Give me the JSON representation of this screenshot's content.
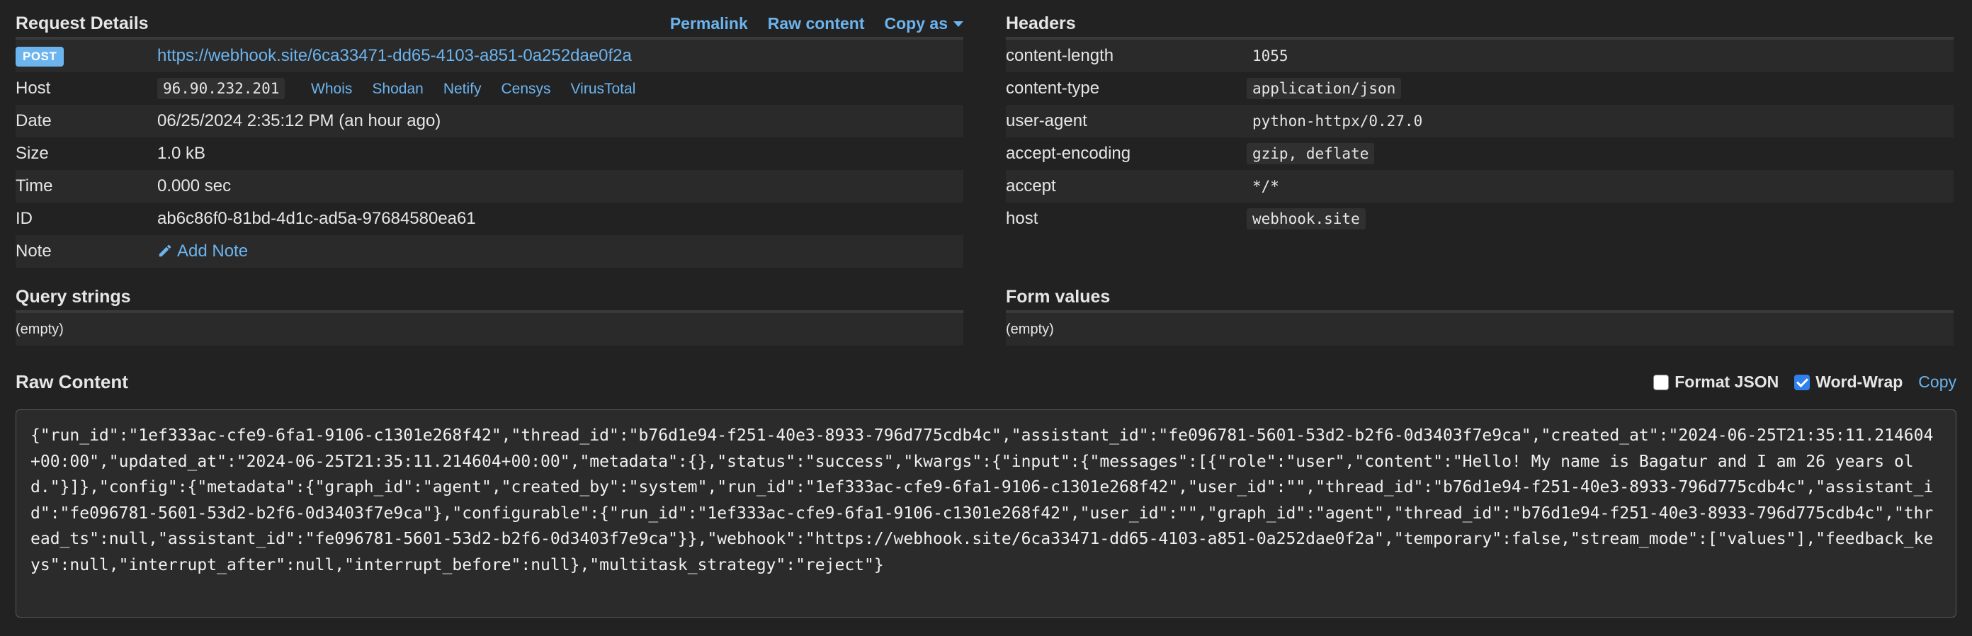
{
  "request": {
    "title": "Request Details",
    "actions": {
      "permalink": "Permalink",
      "raw_content": "Raw content",
      "copy_as": "Copy as"
    },
    "method": "POST",
    "url": "https://webhook.site/6ca33471-dd65-4103-a851-0a252dae0f2a",
    "host_label": "Host",
    "host_ip": "96.90.232.201",
    "lookups": [
      "Whois",
      "Shodan",
      "Netify",
      "Censys",
      "VirusTotal"
    ],
    "date_label": "Date",
    "date_value": "06/25/2024 2:35:12 PM (an hour ago)",
    "size_label": "Size",
    "size_value": "1.0 kB",
    "time_label": "Time",
    "time_value": "0.000 sec",
    "id_label": "ID",
    "id_value": "ab6c86f0-81bd-4d1c-ad5a-97684580ea61",
    "note_label": "Note",
    "add_note": "Add Note"
  },
  "headers": {
    "title": "Headers",
    "rows": [
      {
        "key": "content-length",
        "value": "1055"
      },
      {
        "key": "content-type",
        "value": "application/json"
      },
      {
        "key": "user-agent",
        "value": "python-httpx/0.27.0"
      },
      {
        "key": "accept-encoding",
        "value": "gzip, deflate"
      },
      {
        "key": "accept",
        "value": "*/*"
      },
      {
        "key": "host",
        "value": "webhook.site"
      }
    ]
  },
  "query_strings": {
    "title": "Query strings",
    "value": "(empty)"
  },
  "form_values": {
    "title": "Form values",
    "value": "(empty)"
  },
  "raw_content": {
    "title": "Raw Content",
    "format_json_label": "Format JSON",
    "format_json_checked": false,
    "word_wrap_label": "Word-Wrap",
    "word_wrap_checked": true,
    "copy_label": "Copy",
    "body": "{\"run_id\":\"1ef333ac-cfe9-6fa1-9106-c1301e268f42\",\"thread_id\":\"b76d1e94-f251-40e3-8933-796d775cdb4c\",\"assistant_id\":\"fe096781-5601-53d2-b2f6-0d3403f7e9ca\",\"created_at\":\"2024-06-25T21:35:11.214604+00:00\",\"updated_at\":\"2024-06-25T21:35:11.214604+00:00\",\"metadata\":{},\"status\":\"success\",\"kwargs\":{\"input\":{\"messages\":[{\"role\":\"user\",\"content\":\"Hello! My name is Bagatur and I am 26 years old.\"}]},\"config\":{\"metadata\":{\"graph_id\":\"agent\",\"created_by\":\"system\",\"run_id\":\"1ef333ac-cfe9-6fa1-9106-c1301e268f42\",\"user_id\":\"\",\"thread_id\":\"b76d1e94-f251-40e3-8933-796d775cdb4c\",\"assistant_id\":\"fe096781-5601-53d2-b2f6-0d3403f7e9ca\"},\"configurable\":{\"run_id\":\"1ef333ac-cfe9-6fa1-9106-c1301e268f42\",\"user_id\":\"\",\"graph_id\":\"agent\",\"thread_id\":\"b76d1e94-f251-40e3-8933-796d775cdb4c\",\"thread_ts\":null,\"assistant_id\":\"fe096781-5601-53d2-b2f6-0d3403f7e9ca\"}},\"webhook\":\"https://webhook.site/6ca33471-dd65-4103-a851-0a252dae0f2a\",\"temporary\":false,\"stream_mode\":[\"values\"],\"feedback_keys\":null,\"interrupt_after\":null,\"interrupt_before\":null},\"multitask_strategy\":\"reject\"}"
  },
  "colors": {
    "background": "#222222",
    "link": "#6cb4ee",
    "checkbox_on": "#2f80ed"
  }
}
